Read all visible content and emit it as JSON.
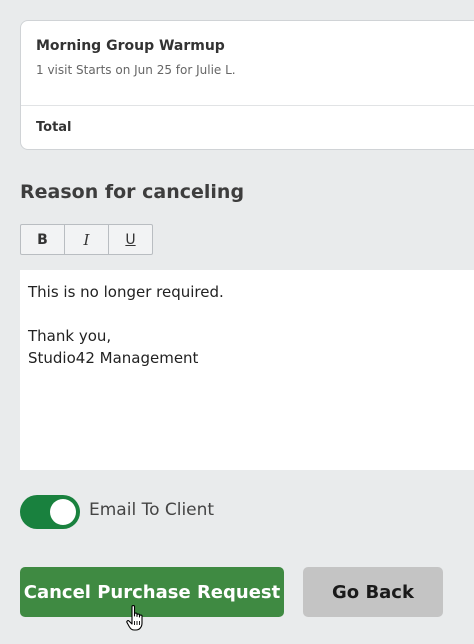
{
  "order": {
    "item_title": "Morning Group Warmup",
    "item_subtitle": "1 visit Starts on Jun 25 for Julie L.",
    "total_label": "Total"
  },
  "cancel_form": {
    "heading": "Reason for canceling",
    "toolbar": {
      "bold": "B",
      "italic": "I",
      "underline": "U"
    },
    "reason_text": "This is no longer required.\n\nThank you,\nStudio42 Management",
    "email_toggle": {
      "label": "Email To Client",
      "checked": true
    }
  },
  "actions": {
    "cancel_label": "Cancel Purchase Request",
    "back_label": "Go Back"
  },
  "colors": {
    "primary_button": "#3f8a42",
    "toggle_on": "#19813e",
    "secondary_button": "#c4c4c4",
    "background": "#e9ebec"
  }
}
